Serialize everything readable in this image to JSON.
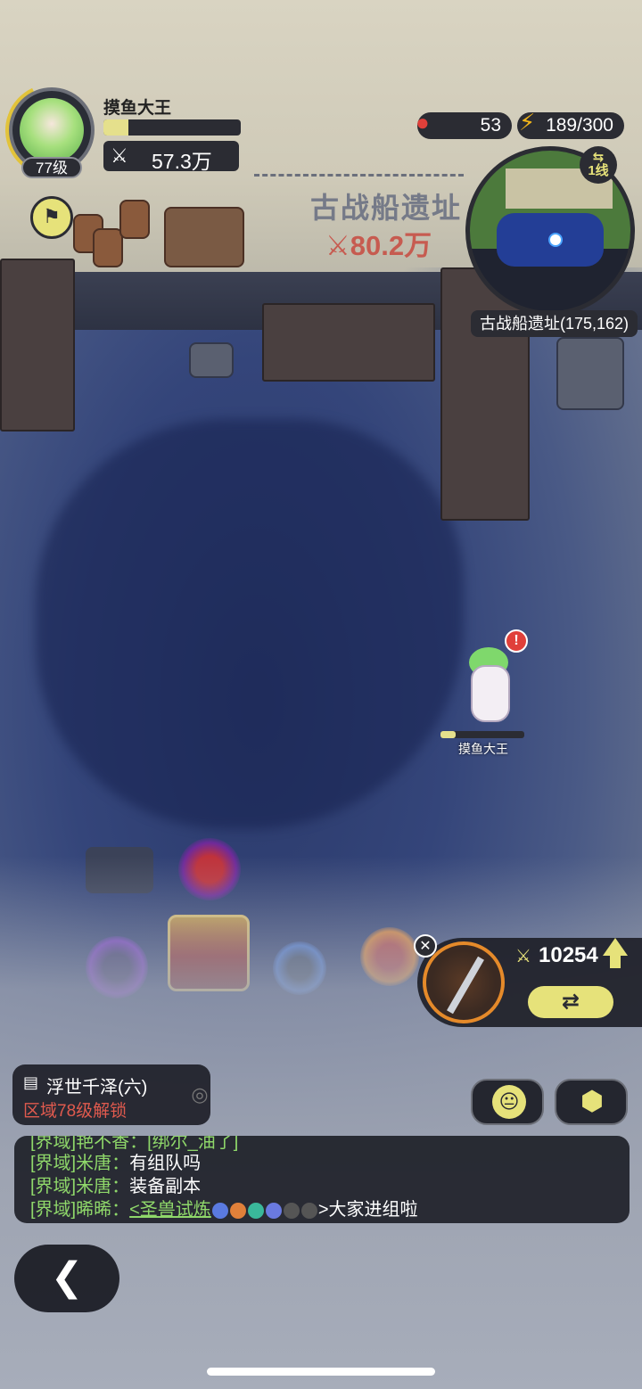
{
  "player": {
    "name": "摸鱼大王",
    "level": "77级",
    "power_icon": "⚔",
    "power": "57.3万",
    "exp_fraction": 0.18
  },
  "resources": {
    "apples": "53",
    "energy": "189/300"
  },
  "zone": {
    "title": "古战船遗址",
    "power": "80.2万"
  },
  "minimap": {
    "line": "1线",
    "location": "古战船遗址(175,162)"
  },
  "character": {
    "name": "摸鱼大王",
    "alert": "!"
  },
  "weapon": {
    "power": "10254"
  },
  "region": {
    "name": "浮世千泽(六)",
    "unlock": "区域78级解锁"
  },
  "chat": {
    "partial": "[界域]艳不香：[绑尔_油了]",
    "lines": [
      {
        "channel": "[界域]米唐：",
        "text": "有组队吗"
      },
      {
        "channel": "[界域]米唐：",
        "text": "装备副本"
      },
      {
        "channel": "[界域]晞晞：",
        "link": "<圣兽试炼",
        "tail": ">大家进组啦"
      }
    ]
  },
  "colors": {
    "accent": "#e6e27a",
    "panel": "#2b2c33",
    "alert": "#e05a4e"
  }
}
